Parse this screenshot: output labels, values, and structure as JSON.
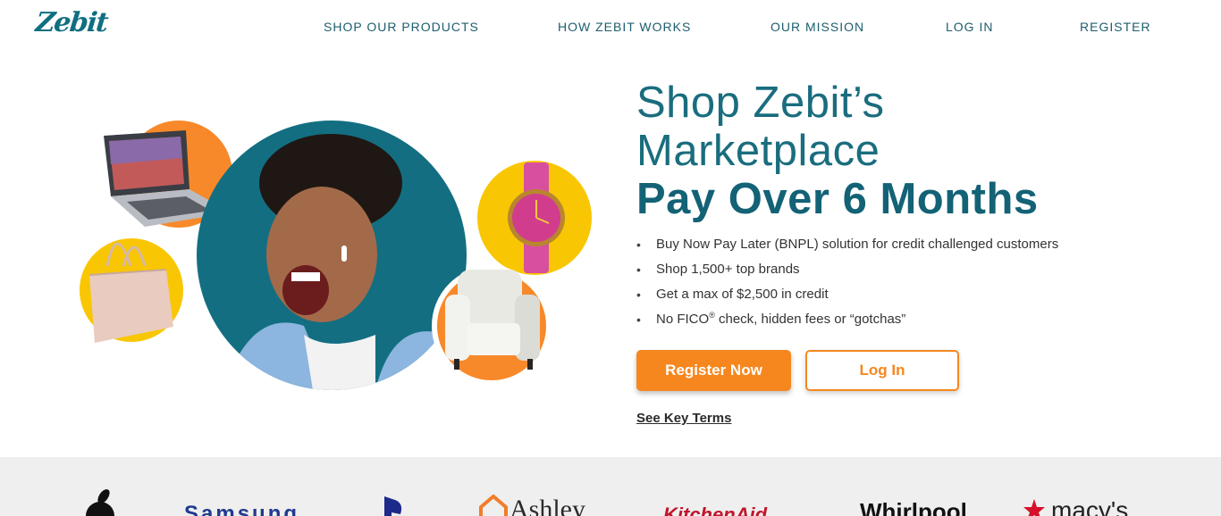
{
  "header": {
    "logo_text": "Zebit",
    "nav": [
      {
        "label": "SHOP OUR PRODUCTS"
      },
      {
        "label": "HOW ZEBIT WORKS"
      },
      {
        "label": "OUR MISSION"
      },
      {
        "label": "LOG IN"
      },
      {
        "label": "REGISTER"
      }
    ]
  },
  "hero": {
    "title_line1": "Shop Zebit’s",
    "title_line2": "Marketplace",
    "title_line3": "Pay Over 6 Months",
    "bullets": [
      "Buy Now Pay Later (BNPL) solution for credit challenged customers",
      "Shop 1,500+ top brands",
      "Get a max of $2,500 in credit",
      "No FICO",
      "® check, hidden fees or “gotchas”"
    ],
    "fico_superscript": "®",
    "fico_rest": " check, hidden fees or “gotchas”",
    "register_button": "Register Now",
    "login_button": "Log In",
    "key_terms_link": "See Key Terms"
  },
  "brands": [
    "Samsung",
    "Ashley",
    "KitchenAid",
    "Whirlpool",
    "macy's"
  ],
  "colors": {
    "teal": "#136e81",
    "orange": "#f6871f",
    "yellow": "#f9c603",
    "strip_bg": "#efefef"
  }
}
